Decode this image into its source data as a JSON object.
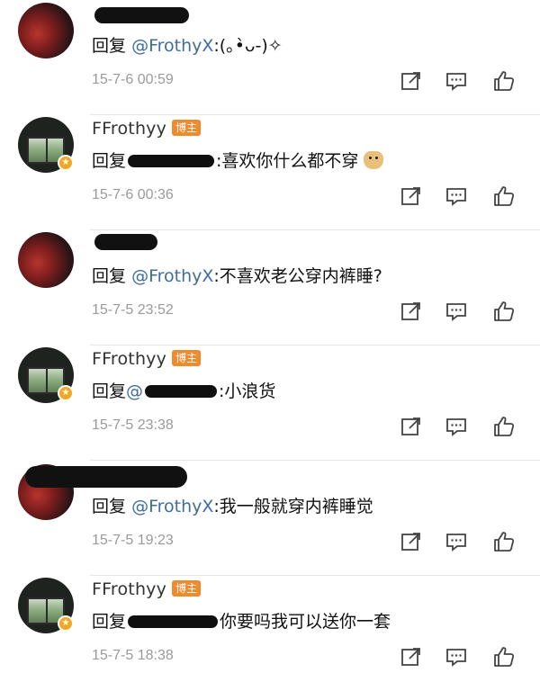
{
  "comments": [
    {
      "type": "other",
      "name_redacted": true,
      "reply_prefix": "回复",
      "mention": "@FrothyX",
      "text": ":(｡•̀ᴗ-)✧",
      "time": "15-7-6 00:59"
    },
    {
      "type": "host",
      "username": "FFrothyy",
      "badge": "博主",
      "reply_prefix": "回复",
      "text": ":喜欢你什么都不穿",
      "time": "15-7-6 00:36"
    },
    {
      "type": "other",
      "name_redacted": true,
      "reply_prefix": "回复",
      "mention": "@FrothyX",
      "text": ":不喜欢老公穿内裤睡?",
      "time": "15-7-5 23:52"
    },
    {
      "type": "host",
      "username": "FFrothyy",
      "badge": "博主",
      "reply_prefix": "回复",
      "text": ":小浪货",
      "time": "15-7-5 23:38"
    },
    {
      "type": "other",
      "name_redacted": true,
      "reply_prefix": "回复",
      "mention": "@FrothyX",
      "text": ":我一般就穿内裤睡觉",
      "time": "15-7-5 19:23"
    },
    {
      "type": "host",
      "username": "FFrothyy",
      "badge": "博主",
      "reply_prefix": "回复",
      "text": "你要吗我可以送你一套",
      "time": "15-7-5 18:38"
    }
  ],
  "icons": {
    "repost": "repost-icon",
    "reply": "comment-icon",
    "like": "thumbs-up-icon",
    "vip": "vip-star-icon"
  },
  "colors": {
    "mention": "#3f6d9e",
    "time": "#9a9a9a",
    "badge": "#f08a2c"
  }
}
